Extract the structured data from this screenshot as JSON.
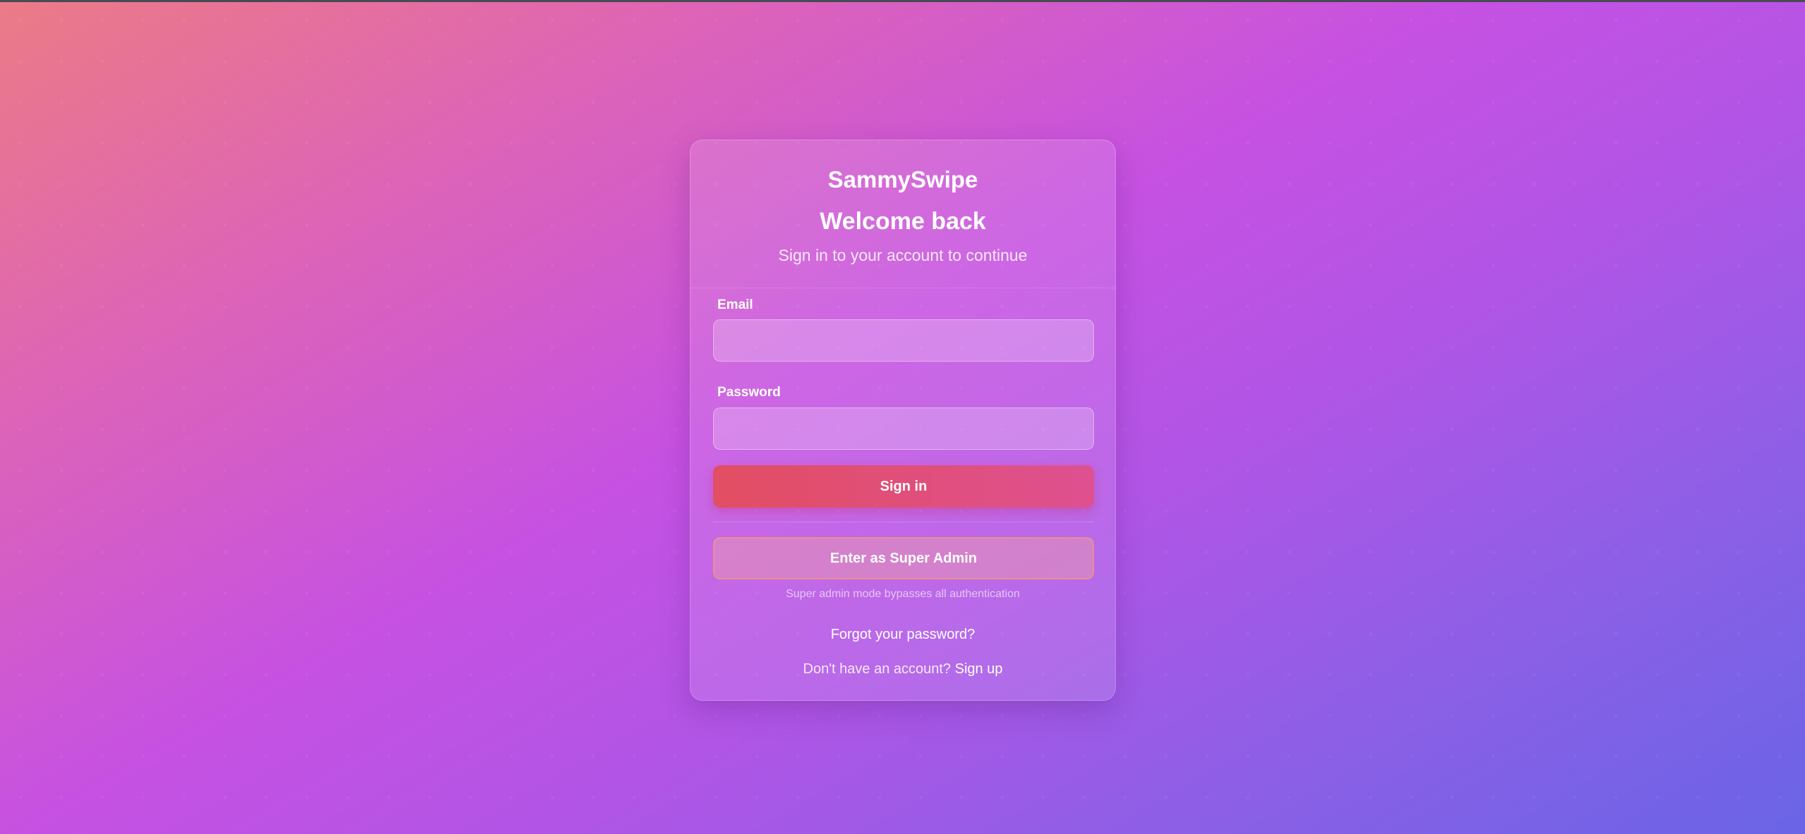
{
  "app": {
    "brand": "SammySwipe"
  },
  "login": {
    "title": "Welcome back",
    "subtitle": "Sign in to your account to continue",
    "email_label": "Email",
    "email_value": "",
    "email_placeholder": "",
    "password_label": "Password",
    "password_value": "",
    "password_placeholder": "",
    "signin_label": "Sign in",
    "admin_label": "Enter as Super Admin",
    "admin_note": "Super admin mode bypasses all authentication",
    "forgot_label": "Forgot your password?",
    "signup_prompt": "Don't have an account?",
    "signup_label": "Sign up"
  },
  "colors": {
    "background_start": "#ec7b86",
    "background_mid": "#c651e2",
    "background_end": "#6a64e6",
    "signin_button_start": "#e24e62",
    "signin_button_end": "#de5090"
  }
}
